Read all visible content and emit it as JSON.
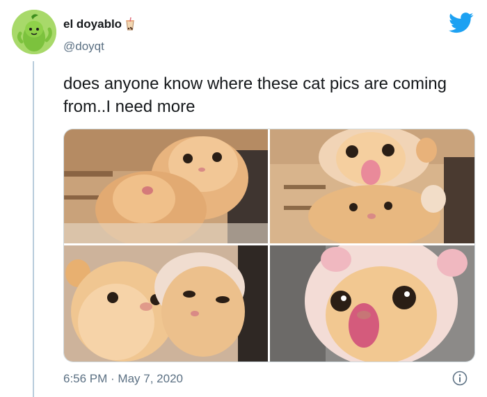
{
  "tweet": {
    "display_name": "el doyablo",
    "handle": "@doyqt",
    "text": "does anyone know where these cat pics are coming from..I need more",
    "timestamp": "6:56 PM · May 7, 2020",
    "name_badge_icon": "boba-tea-icon",
    "brand_icon": "twitter-bird-icon",
    "info_icon": "info-icon"
  },
  "colors": {
    "brand": "#1da1f2",
    "secondary_text": "#5b7083",
    "thread_line": "#b8ccdb"
  },
  "media": [
    {
      "name": "cat-photo-1"
    },
    {
      "name": "cat-photo-2"
    },
    {
      "name": "cat-photo-3"
    },
    {
      "name": "cat-photo-4"
    }
  ]
}
